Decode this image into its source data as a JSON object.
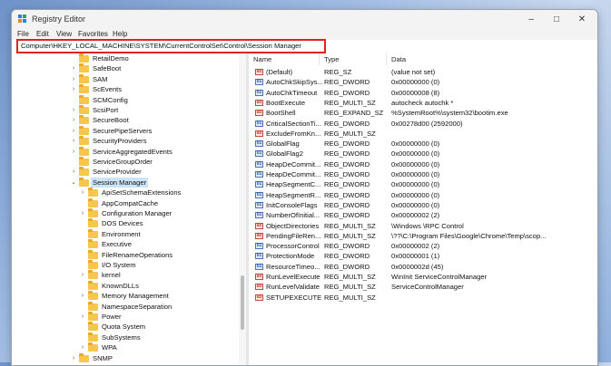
{
  "window": {
    "title": "Registry Editor"
  },
  "menu": [
    "File",
    "Edit",
    "View",
    "Favorites",
    "Help"
  ],
  "address": "Computer\\HKEY_LOCAL_MACHINE\\SYSTEM\\CurrentControlSet\\Control\\Session Manager",
  "tree": [
    {
      "label": "RetailDemo",
      "level": 0,
      "expander": false
    },
    {
      "label": "SafeBoot",
      "level": 0,
      "expander": true
    },
    {
      "label": "SAM",
      "level": 0,
      "expander": true
    },
    {
      "label": "ScEvents",
      "level": 0,
      "expander": true
    },
    {
      "label": "SCMConfig",
      "level": 0,
      "expander": false
    },
    {
      "label": "ScsiPort",
      "level": 0,
      "expander": true
    },
    {
      "label": "SecureBoot",
      "level": 0,
      "expander": true
    },
    {
      "label": "SecurePipeServers",
      "level": 0,
      "expander": true
    },
    {
      "label": "SecurityProviders",
      "level": 0,
      "expander": true
    },
    {
      "label": "ServiceAggregatedEvents",
      "level": 0,
      "expander": true
    },
    {
      "label": "ServiceGroupOrder",
      "level": 0,
      "expander": false
    },
    {
      "label": "ServiceProvider",
      "level": 0,
      "expander": true
    },
    {
      "label": "Session Manager",
      "level": 0,
      "expander": true,
      "expanded": true,
      "selected": true
    },
    {
      "label": "ApiSetSchemaExtensions",
      "level": 1,
      "expander": true
    },
    {
      "label": "AppCompatCache",
      "level": 1,
      "expander": false
    },
    {
      "label": "Configuration Manager",
      "level": 1,
      "expander": true
    },
    {
      "label": "DOS Devices",
      "level": 1,
      "expander": false
    },
    {
      "label": "Environment",
      "level": 1,
      "expander": false
    },
    {
      "label": "Executive",
      "level": 1,
      "expander": false
    },
    {
      "label": "FileRenameOperations",
      "level": 1,
      "expander": false
    },
    {
      "label": "I/O System",
      "level": 1,
      "expander": false
    },
    {
      "label": "kernel",
      "level": 1,
      "expander": true
    },
    {
      "label": "KnownDLLs",
      "level": 1,
      "expander": false
    },
    {
      "label": "Memory Management",
      "level": 1,
      "expander": true
    },
    {
      "label": "NamespaceSeparation",
      "level": 1,
      "expander": false
    },
    {
      "label": "Power",
      "level": 1,
      "expander": true
    },
    {
      "label": "Quota System",
      "level": 1,
      "expander": false
    },
    {
      "label": "SubSystems",
      "level": 1,
      "expander": false
    },
    {
      "label": "WPA",
      "level": 1,
      "expander": true
    },
    {
      "label": "SNMP",
      "level": 0,
      "expander": true
    }
  ],
  "columns": {
    "name": "Name",
    "type": "Type",
    "data": "Data"
  },
  "values": [
    {
      "name": "(Default)",
      "type": "REG_SZ",
      "data": "(value not set)",
      "icon": "sz"
    },
    {
      "name": "AutoChkSkipSys...",
      "type": "REG_DWORD",
      "data": "0x00000000 (0)",
      "icon": "bin"
    },
    {
      "name": "AutoChkTimeout",
      "type": "REG_DWORD",
      "data": "0x00000008 (8)",
      "icon": "bin"
    },
    {
      "name": "BootExecute",
      "type": "REG_MULTI_SZ",
      "data": "autocheck autochk *",
      "icon": "sz"
    },
    {
      "name": "BootShell",
      "type": "REG_EXPAND_SZ",
      "data": "%SystemRoot%\\system32\\bootim.exe",
      "icon": "sz"
    },
    {
      "name": "CriticalSectionTi...",
      "type": "REG_DWORD",
      "data": "0x00278d00 (2592000)",
      "icon": "bin"
    },
    {
      "name": "ExcludeFromKn...",
      "type": "REG_MULTI_SZ",
      "data": "",
      "icon": "sz"
    },
    {
      "name": "GlobalFlag",
      "type": "REG_DWORD",
      "data": "0x00000000 (0)",
      "icon": "bin"
    },
    {
      "name": "GlobalFlag2",
      "type": "REG_DWORD",
      "data": "0x00000000 (0)",
      "icon": "bin"
    },
    {
      "name": "HeapDeCommit...",
      "type": "REG_DWORD",
      "data": "0x00000000 (0)",
      "icon": "bin"
    },
    {
      "name": "HeapDeCommit...",
      "type": "REG_DWORD",
      "data": "0x00000000 (0)",
      "icon": "bin"
    },
    {
      "name": "HeapSegmentC...",
      "type": "REG_DWORD",
      "data": "0x00000000 (0)",
      "icon": "bin"
    },
    {
      "name": "HeapSegmentR...",
      "type": "REG_DWORD",
      "data": "0x00000000 (0)",
      "icon": "bin"
    },
    {
      "name": "InitConsoleFlags",
      "type": "REG_DWORD",
      "data": "0x00000000 (0)",
      "icon": "bin"
    },
    {
      "name": "NumberOfInitial...",
      "type": "REG_DWORD",
      "data": "0x00000002 (2)",
      "icon": "bin"
    },
    {
      "name": "ObjectDirectories",
      "type": "REG_MULTI_SZ",
      "data": "\\Windows \\RPC Control",
      "icon": "sz"
    },
    {
      "name": "PendingFileRen...",
      "type": "REG_MULTI_SZ",
      "data": "\\??\\C:\\Program Files\\Google\\Chrome\\Temp\\scop...",
      "icon": "sz"
    },
    {
      "name": "ProcessorControl",
      "type": "REG_DWORD",
      "data": "0x00000002 (2)",
      "icon": "bin"
    },
    {
      "name": "ProtectionMode",
      "type": "REG_DWORD",
      "data": "0x00000001 (1)",
      "icon": "bin"
    },
    {
      "name": "ResourceTimeo...",
      "type": "REG_DWORD",
      "data": "0x0000002d (45)",
      "icon": "bin"
    },
    {
      "name": "RunLevelExecute",
      "type": "REG_MULTI_SZ",
      "data": "WinInit ServiceControlManager",
      "icon": "sz"
    },
    {
      "name": "RunLevelValidate",
      "type": "REG_MULTI_SZ",
      "data": "ServiceControlManager",
      "icon": "sz"
    },
    {
      "name": "SETUPEXECUTE",
      "type": "REG_MULTI_SZ",
      "data": "",
      "icon": "sz"
    }
  ],
  "colors": {
    "highlight": "#e2221f",
    "selection": "#cce4f7",
    "folder": "#f6c64d"
  }
}
